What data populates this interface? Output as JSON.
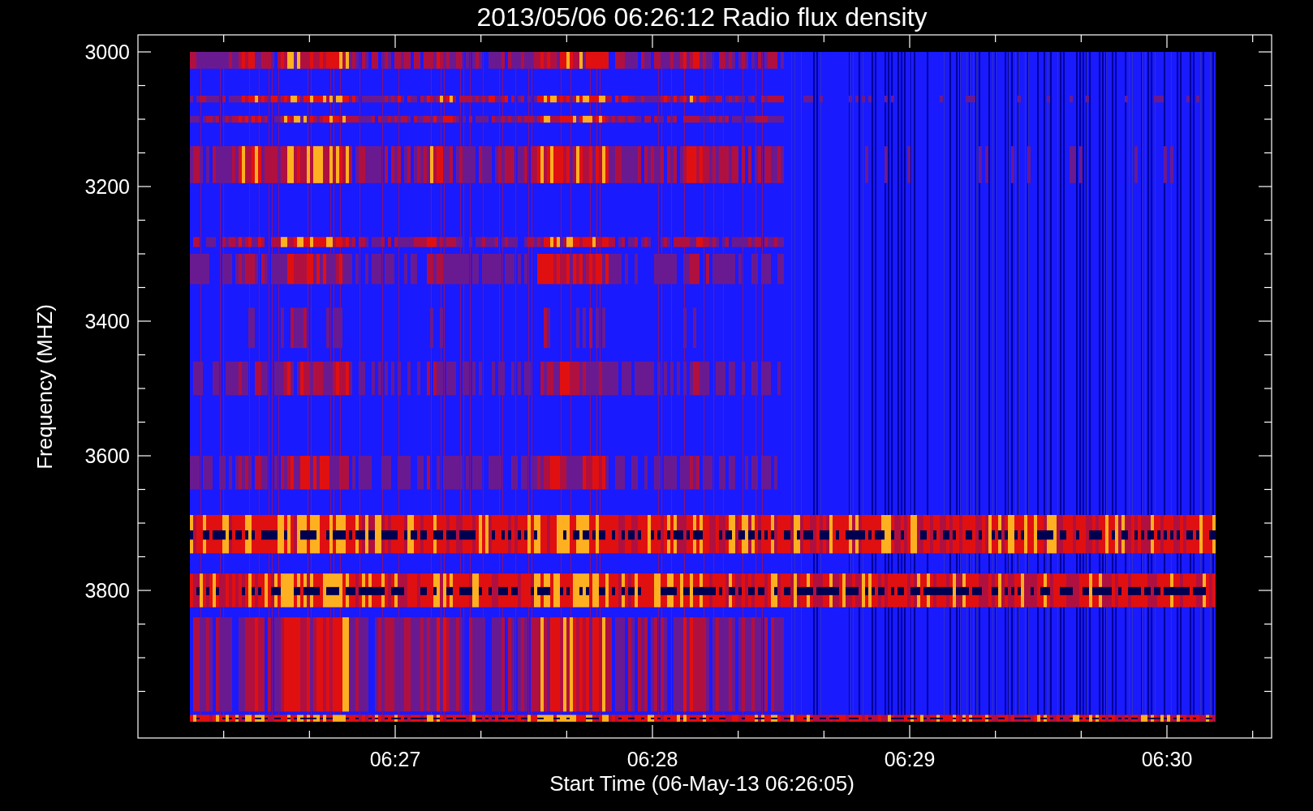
{
  "title": "2013/05/06 06:26:12 Radio flux density",
  "y_axis": {
    "label": "Frequency (MHZ)",
    "ticks": [
      "3000",
      "3200",
      "3400",
      "3600",
      "3800"
    ]
  },
  "x_axis": {
    "label": "Start Time (06-May-13 06:26:05)",
    "ticks": [
      "06:27",
      "06:28",
      "06:29",
      "06:30"
    ]
  }
}
